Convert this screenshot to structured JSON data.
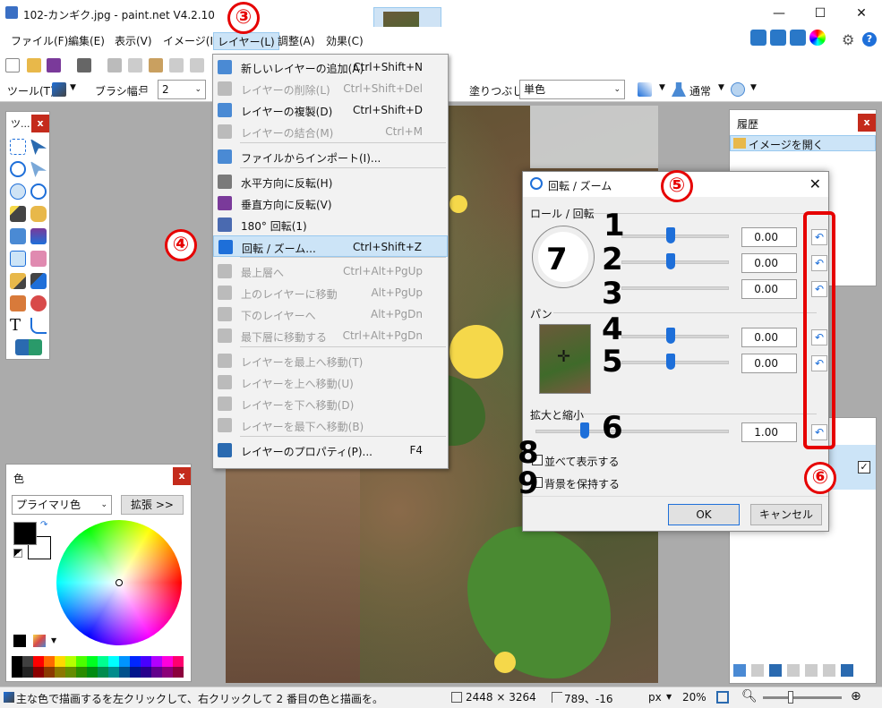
{
  "window": {
    "title": "102-カンギク.jpg - paint.net V4.2.10",
    "buttons": [
      "—",
      "☐",
      "✕"
    ]
  },
  "menubar": {
    "items": [
      {
        "label": "ファイル(F)"
      },
      {
        "label": "編集(E)"
      },
      {
        "label": "表示(V)"
      },
      {
        "label": "イメージ(I)"
      },
      {
        "label": "レイヤー(L)"
      },
      {
        "label": "調整(A)"
      },
      {
        "label": "効果(C)"
      }
    ]
  },
  "toolbar2": {
    "tool_label": "ツール(T):",
    "brush_label": "ブラシ幅:",
    "brush_value": "2",
    "fill_label": "塗りつぶし:",
    "fill_value": "単色",
    "blend_value": "通常"
  },
  "tools_panel": {
    "title": "ツ..."
  },
  "history_panel": {
    "title": "履歴",
    "items": [
      "イメージを開く"
    ]
  },
  "colors_panel": {
    "title": "色",
    "mode_value": "プライマリ色",
    "expand_label": "拡張 >>",
    "palette": [
      "#000000",
      "#404040",
      "#ff0000",
      "#ff6a00",
      "#ffd800",
      "#b6ff00",
      "#4cff00",
      "#00ff21",
      "#00ff90",
      "#00ffff",
      "#0094ff",
      "#0026ff",
      "#4800ff",
      "#b200ff",
      "#ff00dc",
      "#ff006e"
    ]
  },
  "layer_menu": {
    "items": [
      {
        "label": "新しいレイヤーの追加(A)",
        "shortcut": "Ctrl+Shift+N",
        "disabled": false
      },
      {
        "label": "レイヤーの削除(L)",
        "shortcut": "Ctrl+Shift+Del",
        "disabled": true
      },
      {
        "label": "レイヤーの複製(D)",
        "shortcut": "Ctrl+Shift+D",
        "disabled": false
      },
      {
        "label": "レイヤーの結合(M)",
        "shortcut": "Ctrl+M",
        "disabled": true
      },
      {
        "label": "ファイルからインポート(I)...",
        "shortcut": "",
        "disabled": false
      },
      {
        "label": "水平方向に反転(H)",
        "shortcut": "",
        "disabled": false
      },
      {
        "label": "垂直方向に反転(V)",
        "shortcut": "",
        "disabled": false
      },
      {
        "label": "180° 回転(1)",
        "shortcut": "",
        "disabled": false
      },
      {
        "label": "回転 / ズーム...",
        "shortcut": "Ctrl+Shift+Z",
        "disabled": false
      },
      {
        "label": "最上層へ",
        "shortcut": "Ctrl+Alt+PgUp",
        "disabled": true
      },
      {
        "label": "上のレイヤーに移動",
        "shortcut": "Alt+PgUp",
        "disabled": true
      },
      {
        "label": "下のレイヤーへ",
        "shortcut": "Alt+PgDn",
        "disabled": true
      },
      {
        "label": "最下層に移動する",
        "shortcut": "Ctrl+Alt+PgDn",
        "disabled": true
      },
      {
        "label": "レイヤーを最上へ移動(T)",
        "shortcut": "",
        "disabled": true
      },
      {
        "label": "レイヤーを上へ移動(U)",
        "shortcut": "",
        "disabled": true
      },
      {
        "label": "レイヤーを下へ移動(D)",
        "shortcut": "",
        "disabled": true
      },
      {
        "label": "レイヤーを最下へ移動(B)",
        "shortcut": "",
        "disabled": true
      },
      {
        "label": "レイヤーのプロパティ(P)...",
        "shortcut": "F4",
        "disabled": false
      }
    ]
  },
  "dialog": {
    "title": "回転 / ズーム",
    "roll_group": "ロール / 回転",
    "pan_group": "パン",
    "zoom_group": "拡大と縮小",
    "values": [
      "0.00",
      "0.00",
      "0.00",
      "0.00",
      "0.00",
      "1.00"
    ],
    "tile_label": "並べて表示する",
    "keep_bg_label": "背景を保持する",
    "ok_label": "OK",
    "cancel_label": "キャンセル"
  },
  "annotations": {
    "circles": [
      "③",
      "④",
      "⑤",
      "⑥"
    ],
    "numbers": [
      "1",
      "2",
      "3",
      "4",
      "5",
      "6",
      "7",
      "8",
      "9"
    ]
  },
  "statusbar": {
    "hint": "主な色で描画するを左クリックして、右クリックして 2 番目の色と描画を。",
    "size": "2448 × 3264",
    "cursor": "789、-16",
    "unit": "px",
    "zoom": "20%"
  },
  "colors": {
    "accent": "#1e6fd9",
    "annotation_red": "#e60000",
    "menu_highlight": "#cce4f7"
  }
}
